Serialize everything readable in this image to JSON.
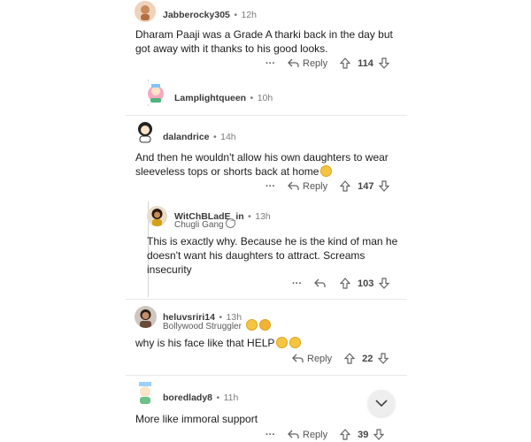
{
  "comments": [
    {
      "username": "Jabberocky305",
      "time": "12h",
      "text": "Dharam Paaji was a Grade A tharki back in the day but got away with it thanks to his good looks.",
      "reply_label": "Reply",
      "votes": "114"
    },
    {
      "username": "Lamplightqueen",
      "time": "10h"
    },
    {
      "username": "dalandrice",
      "time": "14h",
      "text": "And then he wouldn't allow his own daughters to wear sleeveless tops or shorts back at home",
      "reply_label": "Reply",
      "votes": "147"
    },
    {
      "username": "WitChBLadE_in",
      "time": "13h",
      "flair": "Chugli Gang",
      "text": "This is exactly why. Because he is the kind of man he doesn't want his daughters to attract. Screams insecurity",
      "votes": "103"
    },
    {
      "username": "heluvsriri14",
      "time": "13h",
      "flair": "Bollywood Struggler",
      "text": "why is his face like that HELP",
      "reply_label": "Reply",
      "votes": "22"
    },
    {
      "username": "boredlady8",
      "time": "11h",
      "text": "More like immoral support",
      "reply_label": "Reply",
      "votes": "39"
    }
  ],
  "separator": "•",
  "more": "···"
}
